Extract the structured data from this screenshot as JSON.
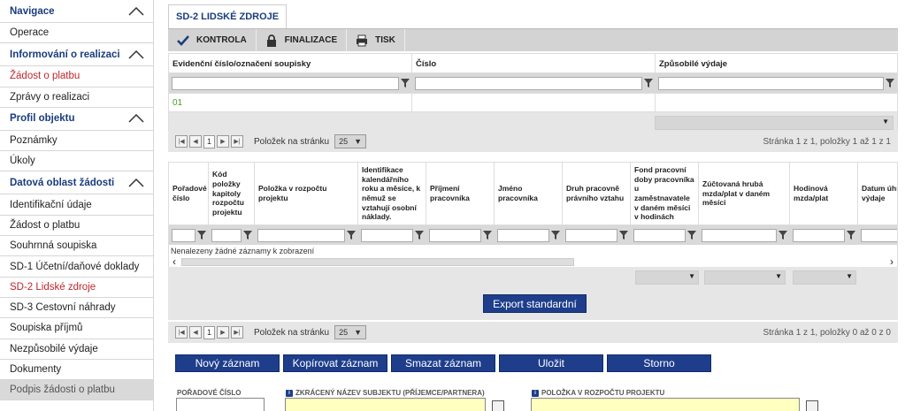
{
  "sidebar": {
    "items": [
      {
        "label": "Navigace",
        "kind": "section"
      },
      {
        "label": "Operace",
        "kind": "item"
      },
      {
        "label": "Informování o realizaci",
        "kind": "section"
      },
      {
        "label": "Žádost o platbu",
        "kind": "active"
      },
      {
        "label": "Zprávy o realizaci",
        "kind": "item"
      },
      {
        "label": "Profil objektu",
        "kind": "section"
      },
      {
        "label": "Poznámky",
        "kind": "item"
      },
      {
        "label": "Úkoly",
        "kind": "item"
      },
      {
        "label": "Datová oblast žádosti",
        "kind": "section"
      },
      {
        "label": "Identifikační údaje",
        "kind": "item"
      },
      {
        "label": "Žádost o platbu",
        "kind": "item"
      },
      {
        "label": "Souhrnná soupiska",
        "kind": "item"
      },
      {
        "label": "SD-1 Účetní/daňové doklady",
        "kind": "item"
      },
      {
        "label": "SD-2 Lidské zdroje",
        "kind": "active"
      },
      {
        "label": "SD-3 Cestovní náhrady",
        "kind": "item"
      },
      {
        "label": "Soupiska příjmů",
        "kind": "item"
      },
      {
        "label": "Nezpůsobilé výdaje",
        "kind": "item"
      },
      {
        "label": "Dokumenty",
        "kind": "item"
      },
      {
        "label": "Podpis žádosti o platbu",
        "kind": "disabled"
      }
    ]
  },
  "tab": {
    "label": "SD-2 LIDSKÉ ZDROJE"
  },
  "toolbar": {
    "kontrola": "KONTROLA",
    "finalizace": "FINALIZACE",
    "tisk": "TISK"
  },
  "grid1": {
    "headers": [
      "Evidenční číslo/označení soupisky",
      "Číslo",
      "Způsobilé výdaje"
    ],
    "row": [
      "01",
      "",
      ""
    ]
  },
  "pager1": {
    "items_label": "Položek na stránku",
    "per_page": "25",
    "page": "1",
    "info": "Stránka 1 z 1, položky 1 až 1 z 1"
  },
  "grid2": {
    "headers": [
      "Pořadové číslo",
      "Kód položky kapitoly rozpočtu projektu",
      "Položka v rozpočtu projektu",
      "Identifikace kalendářního roku a měsíce, k němuž se vztahují osobní náklady.",
      "Příjmení pracovníka",
      "Jméno pracovníka",
      "Druh pracovně právního vztahu",
      "Fond pracovní doby pracovníka u zaměstnavatele v daném měsíci v hodinách",
      "Zúčtovaná hrubá mzda/plat v daném měsíci",
      "Hodinová mzda/plat",
      "Datum úhra výdaje"
    ],
    "empty": "Nenalezeny žádné záznamy k zobrazení"
  },
  "export_label": "Export standardní",
  "pager2": {
    "items_label": "Položek na stránku",
    "per_page": "25",
    "page": "1",
    "info": "Stránka 1 z 1, položky 0 až 0 z 0"
  },
  "actions": {
    "new": "Nový záznam",
    "copy": "Kopírovat záznam",
    "delete": "Smazat záznam",
    "save": "Uložit",
    "cancel": "Storno"
  },
  "form": {
    "poradove": "POŘADOVÉ ČÍSLO",
    "subjekt": "ZKRÁCENÝ NÁZEV SUBJEKTU (PŘÍJEMCE/PARTNERA)",
    "polozka": "POLOŽKA V ROZPOČTU PROJEKTU"
  },
  "colors": {
    "accent": "#1e3e8b",
    "active": "#c0262d",
    "required": "#ffffc0"
  }
}
